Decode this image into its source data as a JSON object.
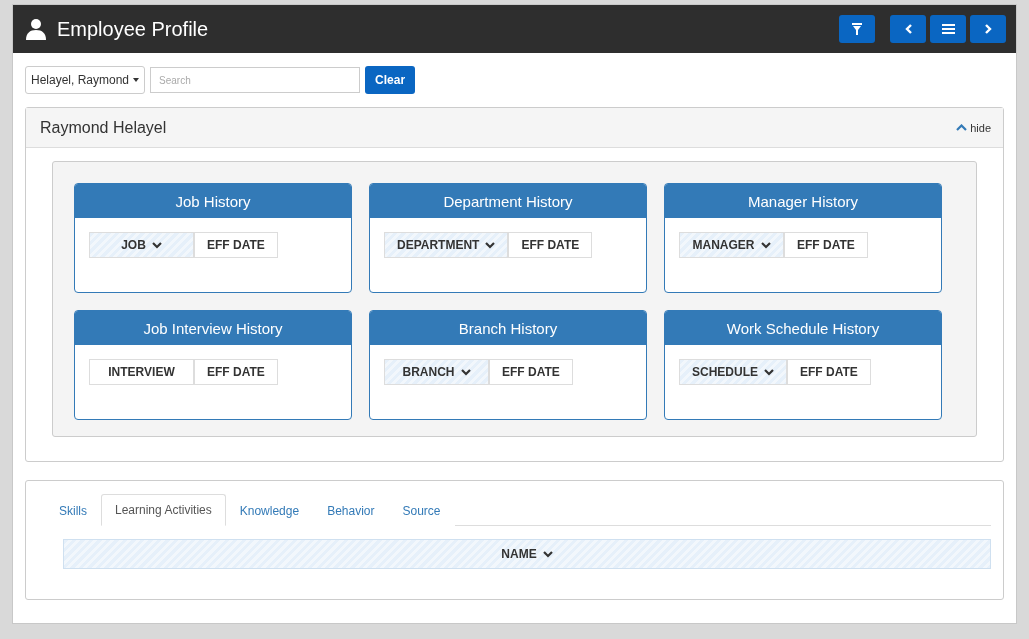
{
  "window": {
    "title": "Employee Profile"
  },
  "toolbar": {
    "employee_select": "Helayel, Raymond",
    "search": {
      "placeholder": "Search"
    },
    "clear_button": "Clear"
  },
  "profile": {
    "name": "Raymond Helayel",
    "toggle": "hide",
    "expanded": true,
    "cards": [
      {
        "title": "Job History",
        "columns": [
          {
            "label": "JOB",
            "sorted": true
          },
          {
            "label": "EFF DATE",
            "sorted": false
          }
        ]
      },
      {
        "title": "Department History",
        "columns": [
          {
            "label": "DEPARTMENT",
            "sorted": true
          },
          {
            "label": "EFF DATE",
            "sorted": false
          }
        ]
      },
      {
        "title": "Manager History",
        "columns": [
          {
            "label": "MANAGER",
            "sorted": true
          },
          {
            "label": "EFF DATE",
            "sorted": false
          }
        ]
      },
      {
        "title": "Job Interview History",
        "columns": [
          {
            "label": "INTERVIEW",
            "sorted": false
          },
          {
            "label": "EFF DATE",
            "sorted": false
          }
        ]
      },
      {
        "title": "Branch History",
        "columns": [
          {
            "label": "BRANCH",
            "sorted": true
          },
          {
            "label": "EFF DATE",
            "sorted": false
          }
        ]
      },
      {
        "title": "Work Schedule History",
        "columns": [
          {
            "label": "SCHEDULE",
            "sorted": true
          },
          {
            "label": "EFF DATE",
            "sorted": false
          }
        ]
      }
    ]
  },
  "tabs": [
    {
      "label": "Skills",
      "selected": false
    },
    {
      "label": "Learning Activities",
      "selected": true
    },
    {
      "label": "Knowledge",
      "selected": false
    },
    {
      "label": "Behavior",
      "selected": false
    },
    {
      "label": "Source",
      "selected": false
    }
  ],
  "table": {
    "columns": [
      {
        "label": "NAME",
        "sorted": true
      }
    ]
  }
}
